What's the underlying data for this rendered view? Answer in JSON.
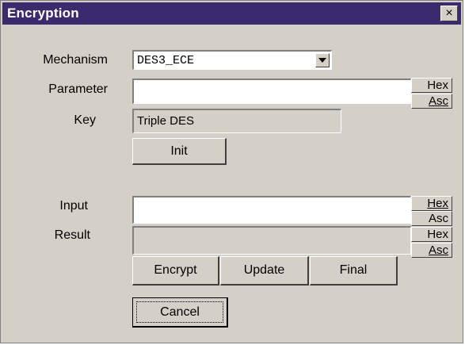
{
  "window": {
    "title": "Encryption",
    "close_glyph": "×"
  },
  "mechanism": {
    "label": "Mechanism",
    "value": "DES3_ECE",
    "dropdown_icon": "chevron-down-icon"
  },
  "parameter": {
    "label": "Parameter",
    "value": "",
    "hex_label": "Hex",
    "asc_label": "Asc"
  },
  "key": {
    "label": "Key",
    "value": "Triple DES"
  },
  "init_button": "Init",
  "input": {
    "label": "Input",
    "value": "",
    "hex_label": "Hex",
    "asc_label": "Asc"
  },
  "result": {
    "label": "Result",
    "value": "",
    "hex_label": "Hex",
    "asc_label": "Asc"
  },
  "action_buttons": {
    "encrypt": "Encrypt",
    "update": "Update",
    "final": "Final"
  },
  "cancel_button": "Cancel",
  "colors": {
    "titlebar": "#3b2a6e",
    "face": "#d4d0c8",
    "field_white": "#ffffff"
  }
}
